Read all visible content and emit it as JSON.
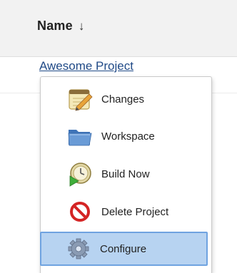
{
  "table": {
    "column_header": "Name",
    "sort_indicator": "↓",
    "project_link": "Awesome Project"
  },
  "context_menu": {
    "items": [
      {
        "label": "Changes",
        "icon": "notepad-pencil-icon"
      },
      {
        "label": "Workspace",
        "icon": "folder-icon"
      },
      {
        "label": "Build Now",
        "icon": "build-clock-icon"
      },
      {
        "label": "Delete Project",
        "icon": "no-entry-icon"
      },
      {
        "label": "Configure",
        "icon": "gear-icon",
        "highlighted": true
      }
    ]
  },
  "colors": {
    "link": "#204a87",
    "highlight_bg": "#b7d3f1",
    "highlight_border": "#6fa3e0",
    "header_bg": "#f2f2f2"
  }
}
